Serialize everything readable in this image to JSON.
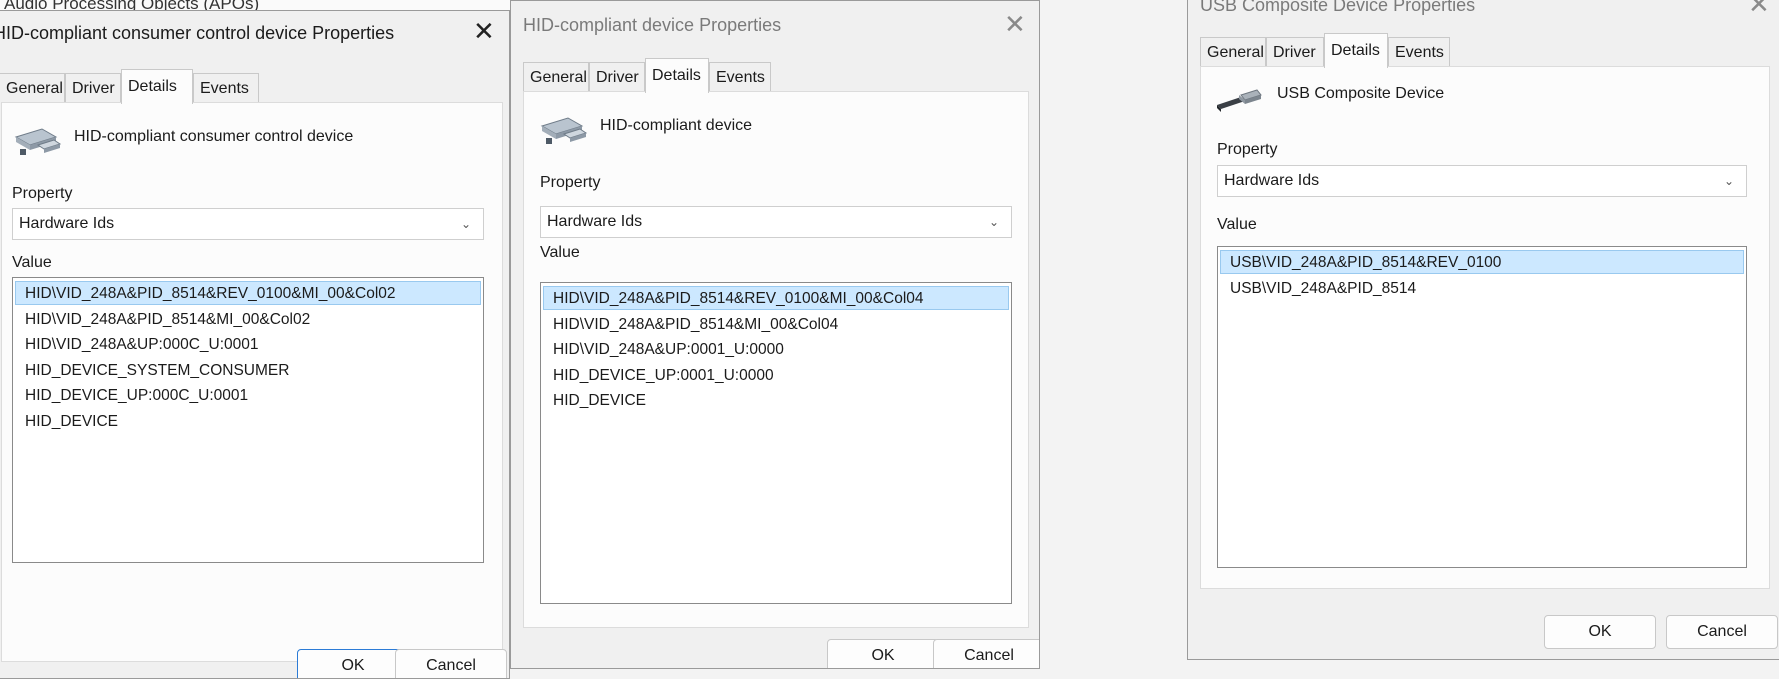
{
  "background_window": {
    "title_fragment": "Audio Processing Objects (APOs)"
  },
  "dialogs": [
    {
      "title": "HID-compliant consumer control device Properties",
      "tabs": [
        "General",
        "Driver",
        "Details",
        "Events"
      ],
      "active_tab": "Details",
      "device_name": "HID-compliant consumer control device",
      "property_label": "Property",
      "property_value": "Hardware Ids",
      "value_label": "Value",
      "values": [
        "HID\\VID_248A&PID_8514&REV_0100&MI_00&Col02",
        "HID\\VID_248A&PID_8514&MI_00&Col02",
        "HID\\VID_248A&UP:000C_U:0001",
        "HID_DEVICE_SYSTEM_CONSUMER",
        "HID_DEVICE_UP:000C_U:0001",
        "HID_DEVICE"
      ],
      "selected_index": 0,
      "ok_label": "OK",
      "cancel_label": "Cancel"
    },
    {
      "title": "HID-compliant device Properties",
      "tabs": [
        "General",
        "Driver",
        "Details",
        "Events"
      ],
      "active_tab": "Details",
      "device_name": "HID-compliant device",
      "property_label": "Property",
      "property_value": "Hardware Ids",
      "value_label": "Value",
      "values": [
        "HID\\VID_248A&PID_8514&REV_0100&MI_00&Col04",
        "HID\\VID_248A&PID_8514&MI_00&Col04",
        "HID\\VID_248A&UP:0001_U:0000",
        "HID_DEVICE_UP:0001_U:0000",
        "HID_DEVICE"
      ],
      "selected_index": 0,
      "ok_label": "OK",
      "cancel_label": "Cancel"
    },
    {
      "title": "USB Composite Device Properties",
      "tabs": [
        "General",
        "Driver",
        "Details",
        "Events"
      ],
      "active_tab": "Details",
      "device_name": "USB Composite Device",
      "property_label": "Property",
      "property_value": "Hardware Ids",
      "value_label": "Value",
      "values": [
        "USB\\VID_248A&PID_8514&REV_0100",
        "USB\\VID_248A&PID_8514"
      ],
      "selected_index": 0,
      "ok_label": "OK",
      "cancel_label": "Cancel"
    }
  ],
  "icons": {
    "close": "close-icon",
    "hid_device": "hid-device-icon",
    "usb_device": "usb-plug-icon",
    "dropdown": "chevron-down-icon"
  },
  "colors": {
    "selection_bg": "#cce8ff",
    "selection_border": "#99c9ef",
    "primary_button_border": "#2b7bd6"
  }
}
